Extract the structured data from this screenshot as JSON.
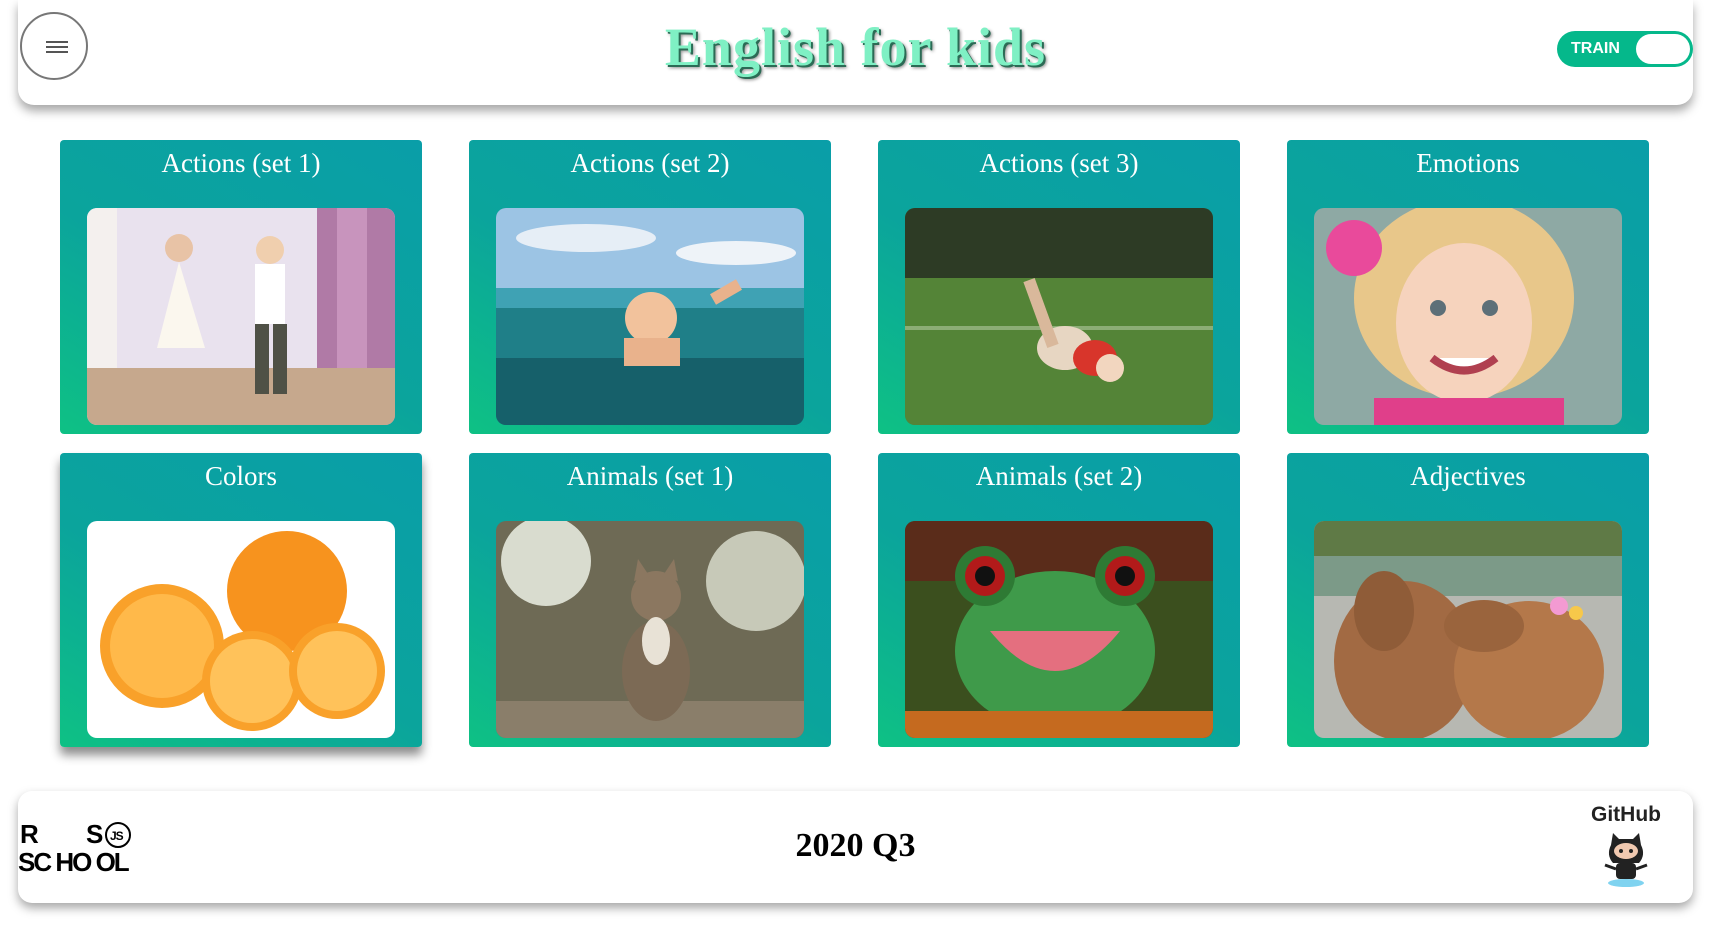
{
  "header": {
    "title": "English for kids",
    "mode_toggle_label": "TRAIN"
  },
  "categories": [
    {
      "label": "Actions (set 1)",
      "image": "children-dancing"
    },
    {
      "label": "Actions (set 2)",
      "image": "child-swimming"
    },
    {
      "label": "Actions (set 3)",
      "image": "child-tumbling-on-grass"
    },
    {
      "label": "Emotions",
      "image": "smiling-girl"
    },
    {
      "label": "Colors",
      "image": "orange-fruit"
    },
    {
      "label": "Animals (set 1)",
      "image": "cat"
    },
    {
      "label": "Animals (set 2)",
      "image": "frog"
    },
    {
      "label": "Adjectives",
      "image": "capybaras"
    }
  ],
  "footer": {
    "school_logo": "RS SCHOOL JS",
    "text": "2020 Q3",
    "github_label": "GitHub"
  },
  "colors": {
    "accent": "#05b88b",
    "card_gradient_top": "#0a9ea8",
    "card_gradient_bottom": "#0ec184",
    "title_color": "#7ff0c4"
  }
}
